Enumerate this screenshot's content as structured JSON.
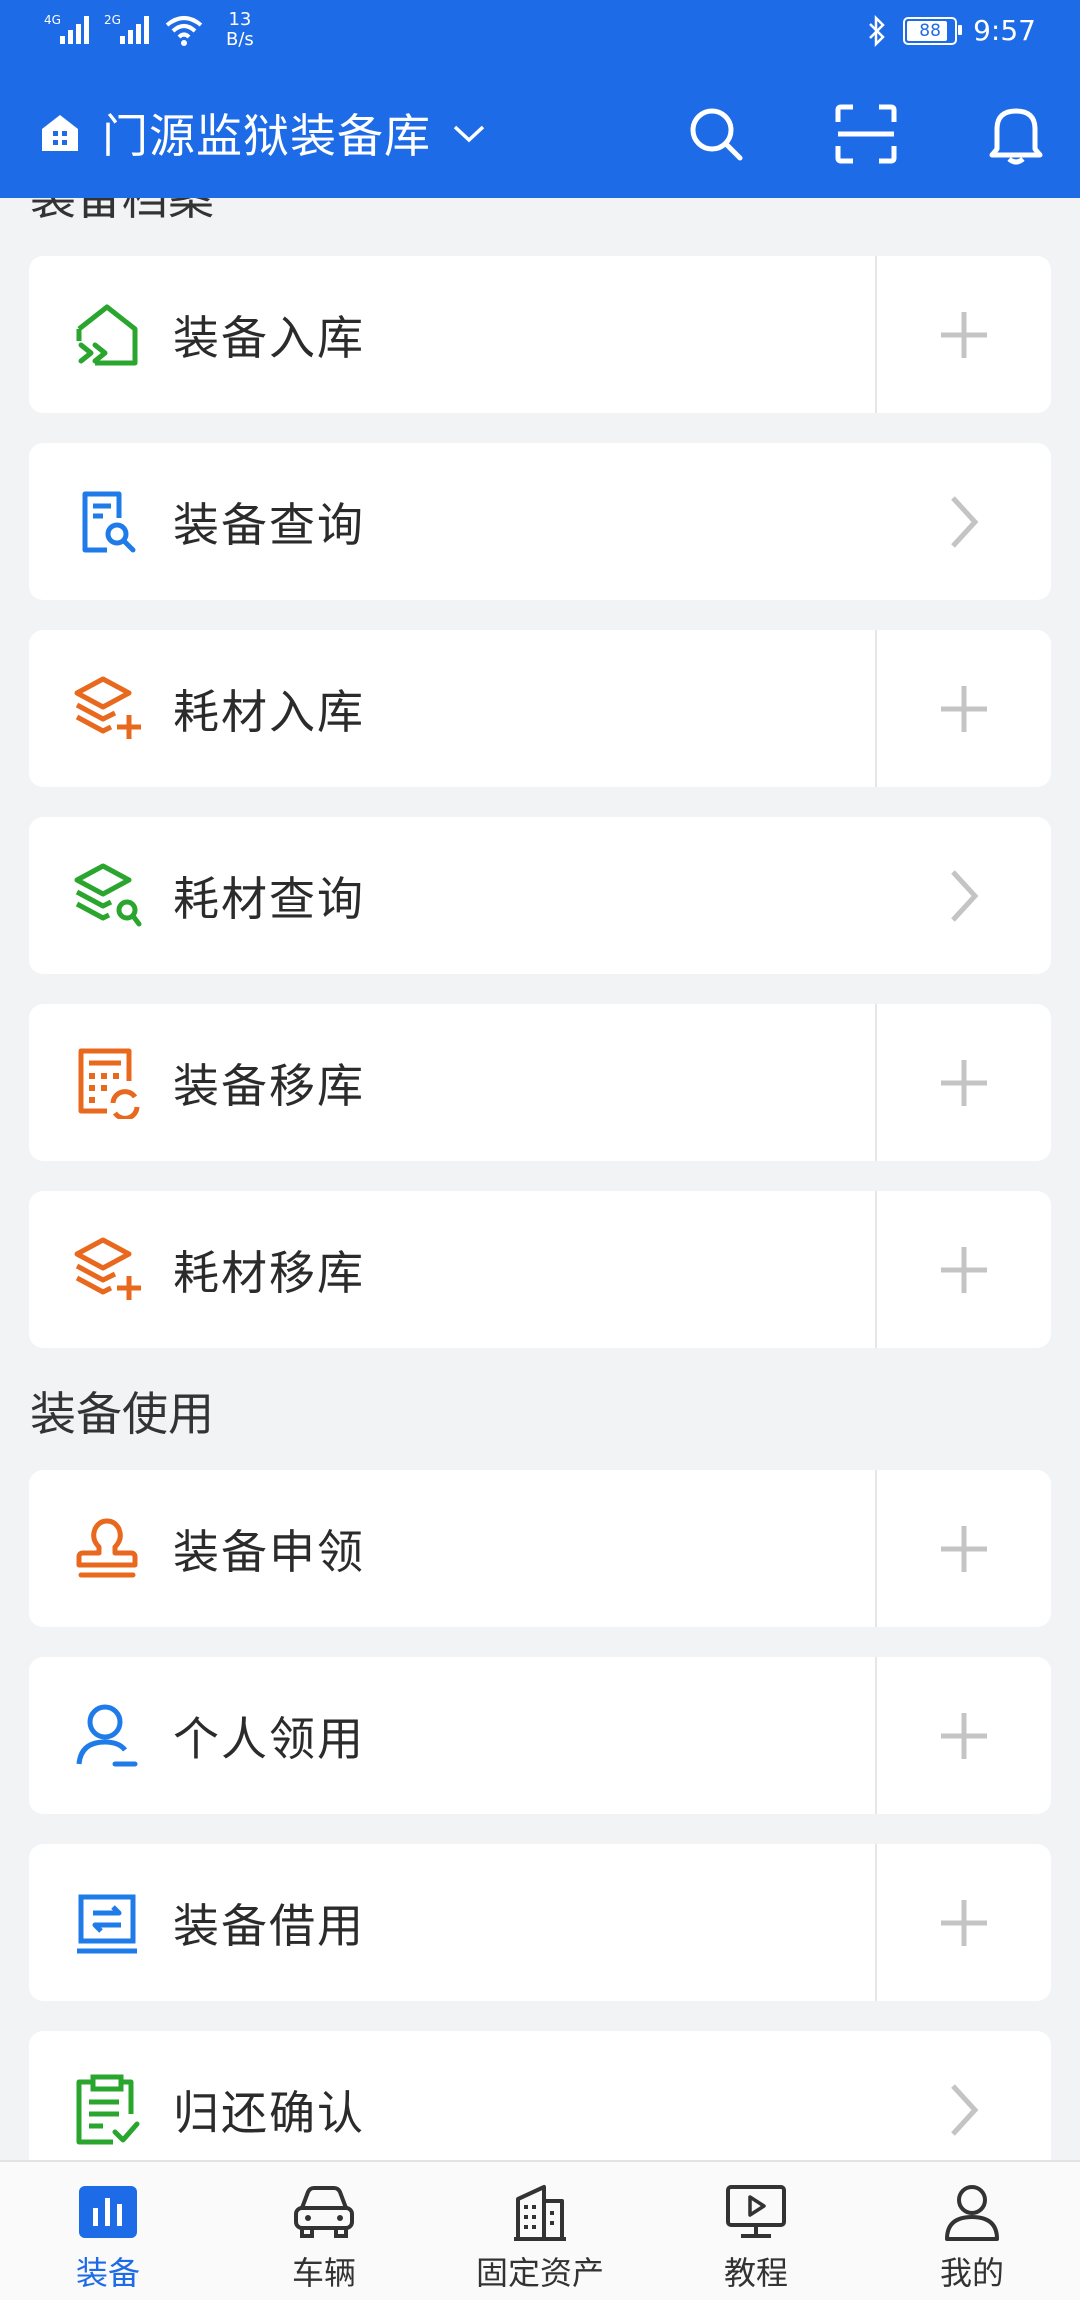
{
  "status_bar": {
    "signal1": "4G",
    "signal2": "2G",
    "speed_value": "13",
    "speed_unit": "B/s",
    "battery": "88",
    "time": "9:57"
  },
  "header": {
    "title": "门源监狱装备库",
    "icons": [
      "home-store-icon",
      "chevron-down-icon",
      "search-icon",
      "scan-icon",
      "bell-icon"
    ]
  },
  "sections": [
    {
      "title": "装备档案",
      "items": [
        {
          "label": "装备入库",
          "icon": "house-enter-icon",
          "action": "plus",
          "color": "#2aa52d"
        },
        {
          "label": "装备查询",
          "icon": "doc-search-icon",
          "action": "arrow",
          "color": "#1e7be8"
        },
        {
          "label": "耗材入库",
          "icon": "layers-plus-icon",
          "action": "plus",
          "color": "#e8691e"
        },
        {
          "label": "耗材查询",
          "icon": "layers-search-icon",
          "action": "arrow",
          "color": "#2aa52d"
        },
        {
          "label": "装备移库",
          "icon": "grid-refresh-icon",
          "action": "plus",
          "color": "#e8691e"
        },
        {
          "label": "耗材移库",
          "icon": "layers-plus-icon",
          "action": "plus",
          "color": "#e8691e"
        }
      ]
    },
    {
      "title": "装备使用",
      "items": [
        {
          "label": "装备申领",
          "icon": "stamp-icon",
          "action": "plus",
          "color": "#e8691e"
        },
        {
          "label": "个人领用",
          "icon": "person-icon",
          "action": "plus",
          "color": "#1e7be8"
        },
        {
          "label": "装备借用",
          "icon": "exchange-icon",
          "action": "plus",
          "color": "#1e7be8"
        },
        {
          "label": "归还确认",
          "icon": "clipboard-check-icon",
          "action": "arrow",
          "color": "#2aa52d"
        }
      ]
    }
  ],
  "tabs": [
    {
      "label": "装备",
      "icon": "chart-icon",
      "active": true
    },
    {
      "label": "车辆",
      "icon": "car-icon",
      "active": false
    },
    {
      "label": "固定资产",
      "icon": "building-icon",
      "active": false
    },
    {
      "label": "教程",
      "icon": "video-screen-icon",
      "active": false
    },
    {
      "label": "我的",
      "icon": "user-icon",
      "active": false
    }
  ],
  "colors": {
    "primary": "#1e6be8",
    "background": "#f2f3f5",
    "green": "#2aa52d",
    "orange": "#e8691e",
    "blue": "#1e7be8"
  }
}
